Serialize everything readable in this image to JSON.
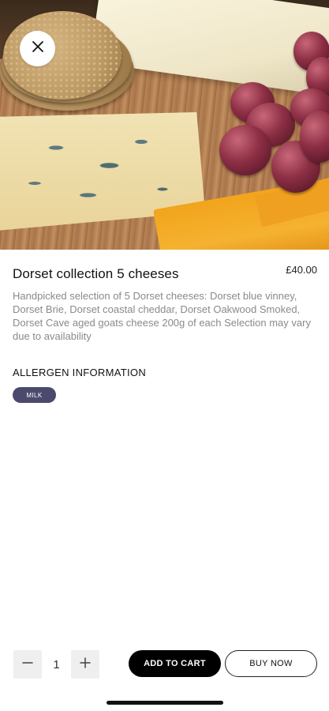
{
  "product": {
    "title": "Dorset collection 5 cheeses",
    "price": "£40.00",
    "description": "Handpicked selection of 5 Dorset cheeses: Dorset blue vinney, Dorset Brie, Dorset coastal cheddar, Dorset Oakwood Smoked, Dorset Cave aged goats cheese 200g of each Selection may vary due to availability",
    "image_icon": "cheese-board-photo"
  },
  "allergens": {
    "heading": "ALLERGEN INFORMATION",
    "items": [
      "MILK"
    ],
    "badge_color": "#4b4a6c"
  },
  "actions": {
    "close_icon": "close-icon",
    "minus_icon": "minus-icon",
    "plus_icon": "plus-icon",
    "quantity": "1",
    "add_to_cart_label": "ADD TO CART",
    "buy_now_label": "BUY NOW",
    "primary_color": "#000000"
  }
}
